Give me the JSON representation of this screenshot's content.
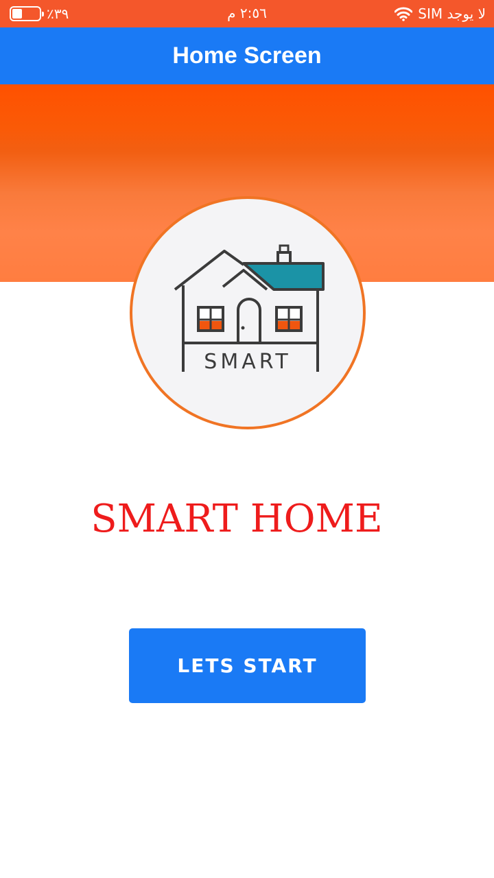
{
  "status_bar": {
    "battery_percent": "٪٣٩",
    "battery_level": 0.39,
    "time": "٢:٥٦ م",
    "carrier": "لا يوجد SIM"
  },
  "app_bar": {
    "title": "Home Screen"
  },
  "logo": {
    "icon": "smart-house-icon",
    "text": "SMART"
  },
  "main": {
    "headline": "SMART HOME",
    "start_button_label": "LETS START"
  },
  "colors": {
    "status_bar": "#f4572b",
    "app_bar": "#1a7af5",
    "hero_band": "#ff5100",
    "logo_border": "#f07424",
    "headline": "#ee1c1c",
    "button": "#1a7af5",
    "roof_accent": "#1b93a6",
    "window_accent": "#f0560f"
  }
}
